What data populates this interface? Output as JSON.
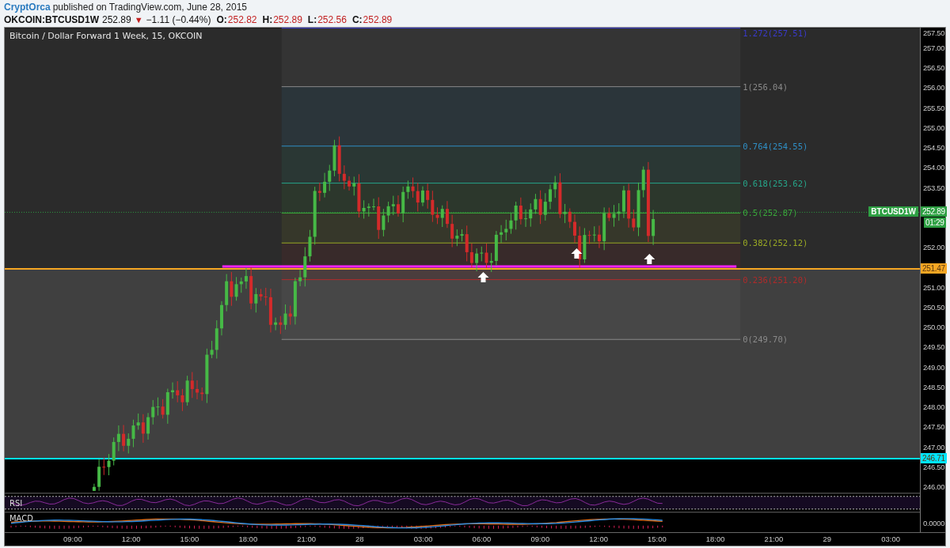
{
  "header": {
    "author": "CryptOrca",
    "published": "published on TradingView.com, June 28, 2015"
  },
  "quote": {
    "symbol": "OKCOIN:BTCUSD1W",
    "last": "252.89",
    "arrow": "▼",
    "change": "−1.11 (−0.44%)",
    "ohlc": [
      {
        "label": "O:",
        "value": "252.82"
      },
      {
        "label": "H:",
        "value": "252.89"
      },
      {
        "label": "L:",
        "value": "252.56"
      },
      {
        "label": "C:",
        "value": "252.89"
      }
    ]
  },
  "chart": {
    "title": "Bitcoin / Dollar Forward 1 Week, 15, OKCOIN",
    "fib_levels": [
      {
        "label": "1.272(257.51)",
        "color": "#3a3acc"
      },
      {
        "label": "1(256.04)",
        "color": "#8a8a8a"
      },
      {
        "label": "0.764(254.55)",
        "color": "#2f8fc6"
      },
      {
        "label": "0.618(253.62)",
        "color": "#26a68a"
      },
      {
        "label": "0.5(252.87)",
        "color": "#3aa93a"
      },
      {
        "label": "0.382(252.12)",
        "color": "#9aaa24"
      },
      {
        "label": "0.236(251.20)",
        "color": "#b02a2a"
      },
      {
        "label": "0(249.70)",
        "color": "#8a8a8a"
      }
    ],
    "series_label": "BTCUSD1W",
    "countdown": "01:29",
    "price_badges": [
      {
        "text": "252.89",
        "kind": "last",
        "color": "#2ea043"
      },
      {
        "text": "251.47",
        "kind": "line",
        "color": "#f5a623"
      },
      {
        "text": "246.71",
        "kind": "line",
        "color": "#00e5ff"
      }
    ],
    "price_ticks": [
      "257.50",
      "257.00",
      "256.50",
      "256.00",
      "255.50",
      "255.00",
      "254.50",
      "254.00",
      "253.50",
      "252.00",
      "251.00",
      "250.50",
      "250.00",
      "249.50",
      "249.00",
      "248.50",
      "248.00",
      "247.50",
      "247.00",
      "246.50",
      "246.00"
    ],
    "panes": [
      {
        "label": "RSI"
      },
      {
        "label": "MACD",
        "tick": "0.0000"
      }
    ],
    "time_axis": [
      "09:00",
      "12:00",
      "15:00",
      "18:00",
      "21:00",
      "28",
      "03:00",
      "06:00",
      "09:00",
      "12:00",
      "15:00",
      "18:00",
      "21:00",
      "29",
      "03:00"
    ]
  }
}
